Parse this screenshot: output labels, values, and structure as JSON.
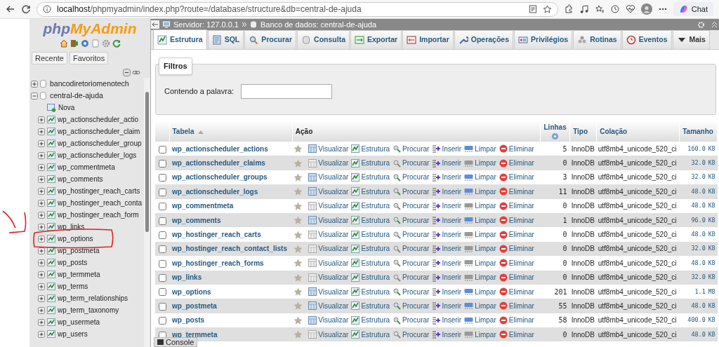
{
  "browser": {
    "url_host": "localhost",
    "url_path": "/phpmyadmin/index.php?route=/database/structure&db=central-de-ajuda",
    "copilot_label": "Chat"
  },
  "sidebar": {
    "logo": [
      "php",
      "MyAdmin"
    ],
    "tabs": [
      "Recente",
      "Favoritos"
    ],
    "tree": [
      {
        "name": "bancodiretoriomenotech",
        "expanded": false
      },
      {
        "name": "central-de-ajuda",
        "expanded": true,
        "children": [
          {
            "name": "Nova",
            "kind": "new",
            "circled": false
          },
          {
            "name": "wp_actionscheduler_actio",
            "kind": "table",
            "circled": false
          },
          {
            "name": "wp_actionscheduler_claim",
            "kind": "table",
            "circled": false
          },
          {
            "name": "wp_actionscheduler_group",
            "kind": "table",
            "circled": false
          },
          {
            "name": "wp_actionscheduler_logs",
            "kind": "table",
            "circled": false
          },
          {
            "name": "wp_commentmeta",
            "kind": "table",
            "circled": false
          },
          {
            "name": "wp_comments",
            "kind": "table",
            "circled": false
          },
          {
            "name": "wp_hostinger_reach_carts",
            "kind": "table",
            "circled": false
          },
          {
            "name": "wp_hostinger_reach_conta",
            "kind": "table",
            "circled": false
          },
          {
            "name": "wp_hostinger_reach_form",
            "kind": "table",
            "circled": false
          },
          {
            "name": "wp_links",
            "kind": "table",
            "circled": false
          },
          {
            "name": "wp_options",
            "kind": "table",
            "circled": true
          },
          {
            "name": "wp_postmeta",
            "kind": "table",
            "circled": false
          },
          {
            "name": "wp_posts",
            "kind": "table",
            "circled": false
          },
          {
            "name": "wp_termmeta",
            "kind": "table",
            "circled": false
          },
          {
            "name": "wp_terms",
            "kind": "table",
            "circled": false
          },
          {
            "name": "wp_term_relationships",
            "kind": "table",
            "circled": false
          },
          {
            "name": "wp_term_taxonomy",
            "kind": "table",
            "circled": false
          },
          {
            "name": "wp_usermeta",
            "kind": "table",
            "circled": false
          },
          {
            "name": "wp_users",
            "kind": "table",
            "circled": false
          }
        ]
      }
    ]
  },
  "breadcrumb": [
    "Servidor: 127.0.0.1",
    "Banco de dados: central-de-ajuda"
  ],
  "tabs": [
    {
      "label": "Estrutura",
      "kind": "structure",
      "selected": true
    },
    {
      "label": "SQL",
      "kind": "sql",
      "selected": false
    },
    {
      "label": "Procurar",
      "kind": "search",
      "selected": false
    },
    {
      "label": "Consulta",
      "kind": "query",
      "selected": false
    },
    {
      "label": "Exportar",
      "kind": "export",
      "selected": false
    },
    {
      "label": "Importar",
      "kind": "import",
      "selected": false
    },
    {
      "label": "Operações",
      "kind": "wrench",
      "selected": false
    },
    {
      "label": "Privilégios",
      "kind": "privileges",
      "selected": false
    },
    {
      "label": "Rotinas",
      "kind": "routines",
      "selected": false
    },
    {
      "label": "Eventos",
      "kind": "clock",
      "selected": false
    },
    {
      "label": "Mais",
      "kind": "more",
      "selected": false
    }
  ],
  "filter": {
    "legend": "Filtros",
    "label": "Contendo a palavra:"
  },
  "table": {
    "columns": [
      "Tabela",
      "Ação",
      "Linhas",
      "Tipo",
      "Colação",
      "Tamanho"
    ],
    "rows": [
      {
        "name": "wp_actionscheduler_actions",
        "checked": false,
        "empty": false,
        "actions": [
          "Visualizar",
          "Estrutura",
          "Procurar",
          "Inserir",
          "Limpar",
          "Eliminar"
        ],
        "rows": "5",
        "type": "InnoDB",
        "collation": "utf8mb4_unicode_520_ci",
        "size": "160.0",
        "unit": "KB"
      },
      {
        "name": "wp_actionscheduler_claims",
        "checked": false,
        "empty": true,
        "actions": [
          "Visualizar",
          "Estrutura",
          "Procurar",
          "Inserir",
          "Limpar",
          "Eliminar"
        ],
        "rows": "0",
        "type": "InnoDB",
        "collation": "utf8mb4_unicode_520_ci",
        "size": "32.0",
        "unit": "KB"
      },
      {
        "name": "wp_actionscheduler_groups",
        "checked": false,
        "empty": false,
        "actions": [
          "Visualizar",
          "Estrutura",
          "Procurar",
          "Inserir",
          "Limpar",
          "Eliminar"
        ],
        "rows": "3",
        "type": "InnoDB",
        "collation": "utf8mb4_unicode_520_ci",
        "size": "32.0",
        "unit": "KB"
      },
      {
        "name": "wp_actionscheduler_logs",
        "checked": false,
        "empty": false,
        "actions": [
          "Visualizar",
          "Estrutura",
          "Procurar",
          "Inserir",
          "Limpar",
          "Eliminar"
        ],
        "rows": "11",
        "type": "InnoDB",
        "collation": "utf8mb4_unicode_520_ci",
        "size": "48.0",
        "unit": "KB"
      },
      {
        "name": "wp_commentmeta",
        "checked": false,
        "empty": true,
        "actions": [
          "Visualizar",
          "Estrutura",
          "Procurar",
          "Inserir",
          "Limpar",
          "Eliminar"
        ],
        "rows": "0",
        "type": "InnoDB",
        "collation": "utf8mb4_unicode_520_ci",
        "size": "48.0",
        "unit": "KB"
      },
      {
        "name": "wp_comments",
        "checked": false,
        "empty": false,
        "actions": [
          "Visualizar",
          "Estrutura",
          "Procurar",
          "Inserir",
          "Limpar",
          "Eliminar"
        ],
        "rows": "1",
        "type": "InnoDB",
        "collation": "utf8mb4_unicode_520_ci",
        "size": "96.0",
        "unit": "KB"
      },
      {
        "name": "wp_hostinger_reach_carts",
        "checked": false,
        "empty": true,
        "actions": [
          "Visualizar",
          "Estrutura",
          "Procurar",
          "Inserir",
          "Limpar",
          "Eliminar"
        ],
        "rows": "0",
        "type": "InnoDB",
        "collation": "utf8mb4_unicode_520_ci",
        "size": "48.0",
        "unit": "KB"
      },
      {
        "name": "wp_hostinger_reach_contact_lists",
        "checked": false,
        "empty": true,
        "actions": [
          "Visualizar",
          "Estrutura",
          "Procurar",
          "Inserir",
          "Limpar",
          "Eliminar"
        ],
        "rows": "0",
        "type": "InnoDB",
        "collation": "utf8mb4_unicode_520_ci",
        "size": "32.0",
        "unit": "KB"
      },
      {
        "name": "wp_hostinger_reach_forms",
        "checked": false,
        "empty": true,
        "actions": [
          "Visualizar",
          "Estrutura",
          "Procurar",
          "Inserir",
          "Limpar",
          "Eliminar"
        ],
        "rows": "0",
        "type": "InnoDB",
        "collation": "utf8mb4_unicode_520_ci",
        "size": "48.0",
        "unit": "KB"
      },
      {
        "name": "wp_links",
        "checked": false,
        "empty": true,
        "actions": [
          "Visualizar",
          "Estrutura",
          "Procurar",
          "Inserir",
          "Limpar",
          "Eliminar"
        ],
        "rows": "0",
        "type": "InnoDB",
        "collation": "utf8mb4_unicode_520_ci",
        "size": "32.0",
        "unit": "KB"
      },
      {
        "name": "wp_options",
        "checked": false,
        "empty": false,
        "actions": [
          "Visualizar",
          "Estrutura",
          "Procurar",
          "Inserir",
          "Limpar",
          "Eliminar"
        ],
        "rows": "201",
        "type": "InnoDB",
        "collation": "utf8mb4_unicode_520_ci",
        "size": "1.1",
        "unit": "MB"
      },
      {
        "name": "wp_postmeta",
        "checked": false,
        "empty": false,
        "actions": [
          "Visualizar",
          "Estrutura",
          "Procurar",
          "Inserir",
          "Limpar",
          "Eliminar"
        ],
        "rows": "55",
        "type": "InnoDB",
        "collation": "utf8mb4_unicode_520_ci",
        "size": "48.0",
        "unit": "KB"
      },
      {
        "name": "wp_posts",
        "checked": false,
        "empty": false,
        "actions": [
          "Visualizar",
          "Estrutura",
          "Procurar",
          "Inserir",
          "Limpar",
          "Eliminar"
        ],
        "rows": "58",
        "type": "InnoDB",
        "collation": "utf8mb4_unicode_520_ci",
        "size": "400.0",
        "unit": "KB"
      },
      {
        "name": "wp_termmeta",
        "checked": false,
        "empty": true,
        "actions": [
          "Visualizar",
          "Estrutura",
          "Procurar",
          "Inserir",
          "Limpar",
          "Eliminar"
        ],
        "rows": "0",
        "type": "InnoDB",
        "collation": "utf8mb4_unicode_520_ci",
        "size": "48.0",
        "unit": "KB"
      }
    ]
  },
  "console": "Console"
}
